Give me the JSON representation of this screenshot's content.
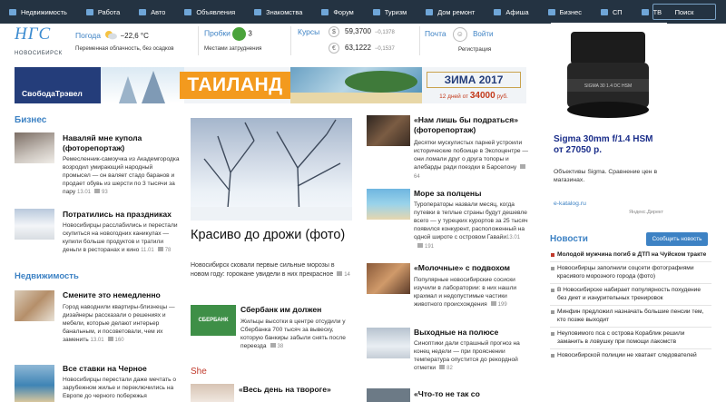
{
  "nav": {
    "items": [
      "Недвижимость",
      "Работа",
      "Авто",
      "Объявления",
      "Знакомства",
      "Форум",
      "Туризм",
      "Дом ремонт",
      "Афиша",
      "Бизнес",
      "СП",
      "ТВ"
    ],
    "search_label": "Поиск"
  },
  "header": {
    "logo": "НГС",
    "city": "НОВОСИБИРСК",
    "weather_label": "Погода",
    "weather_value": "−22,6 °С",
    "weather_sub": "Переменная облачность, без осадков",
    "traffic_label": "Пробки",
    "traffic_value": "3",
    "traffic_sub": "Местами затруднения",
    "rates_label": "Курсы",
    "usd_value": "59,3700",
    "usd_change": "−0,1378",
    "eur_value": "63,1222",
    "eur_change": "−0,1537",
    "usd_symbol": "$",
    "eur_symbol": "€",
    "mail_label": "Почта",
    "login_label": "Войти",
    "register_label": "Регистрация"
  },
  "banner": {
    "brand": "СвободаТрэвел",
    "destination": "ТАИЛАНД",
    "season": "ЗИМА 2017",
    "price_prefix": "12 дней от",
    "price": "34000",
    "price_suffix": "руб."
  },
  "sections": {
    "business": "Бизнес",
    "realty": "Недвижимость",
    "she": "She"
  },
  "left_articles": [
    {
      "title": "Наваляй мне купола (фоторепортаж)",
      "text": "Ремесленник-самоучка из Академгородка возродил умирающий народный промысел — он валяет стадо баранов и продает обувь из шерсти по 3 тысячи за пару",
      "date": "13.01",
      "comments": "93"
    },
    {
      "title": "Потратились на праздниках",
      "text": "Новосибирцы расслабились и перестали скупиться на новогодних каникулах — купили больше продуктов и тратили деньги в ресторанах и кино",
      "date": "11.01",
      "comments": "78"
    },
    {
      "title": "Смените это немедленно",
      "text": "Город наводнили квартиры-близнецы — дизайнеры рассказали о решениях и мебели, которые делают интерьер банальным, и посоветовали, чем их заменить",
      "date": "13.01",
      "comments": "160"
    },
    {
      "title": "Все ставки на Черное",
      "text": "Новосибирцы перестали даже мечтать о зарубежном жилье и переключились на Европе до черного побережья",
      "date": "",
      "comments": ""
    }
  ],
  "lead": {
    "title": "Красиво до дрожи (фото)",
    "text": "Новосибирск сковали первые сильные морозы в новом году: горожане увидели в них прекрасное",
    "comments": "14"
  },
  "mid_article": {
    "title": "Сбербанк им должен",
    "text": "Жильцы высотки в центре отсудили у Сбербанка 700 тысяч за вывеску, которую банкиры забыли снять после переезда",
    "comments": "38",
    "logo_text": "СБЕРБАНК"
  },
  "she_article": {
    "title": "«Весь день на творогe»"
  },
  "right_articles": [
    {
      "title": "«Нам лишь бы подраться» (фоторепортаж)",
      "text": "Десятки мускулистых парней устроили исторические побоище в Экспоцентре — они ломали друг о друга топоры и алебарды ради поездки в Барселону",
      "comments": "64"
    },
    {
      "title": "Море за полцены",
      "text": "Туроператоры назвали месяц, когда путевки в теплые страны будут дешевле всего — у турецких курортов за 25 тысяч появился конкурент, расположенный на одной широте с островом Гавайи",
      "date": "13.01",
      "comments": "191"
    },
    {
      "title": "«Молочные» с подвохом",
      "text": "Популярные новосибирские сосиски изучили в лаборатории: в них нашли крахмал и недопустимые частики животного происхождения",
      "comments": "199"
    },
    {
      "title": "Выходные на полюсе",
      "text": "Синоптики дали страшный прогноз на конец недели — при прояснении температура опустится до рекордной отметки",
      "comments": "82"
    },
    {
      "title": "«Что-то не так со"
    }
  ],
  "ad": {
    "title": "Sigma 30mm f/1.4 HSM от 27050 р.",
    "text": "Объективы Sigma. Сравнение цен в магазинах.",
    "link": "e-katalog.ru",
    "source": "Яндекс.Директ"
  },
  "news": {
    "heading": "Новости",
    "button": "Сообщить новость",
    "items": [
      {
        "text": "Молодой мужчина погиб в ДТП на Чуйском тракте",
        "hot": true
      },
      {
        "text": "Новосибирцы заполнили соцсети фотографиями красивого морозного города (фото)",
        "hot": false
      },
      {
        "text": "В Новосибирске набирает популярность похудение без диет и изнурительных тренировок",
        "hot": false
      },
      {
        "text": "Минфин предложил назначать большие пенсии тем, кто позже выходит",
        "hot": false
      },
      {
        "text": "Неуловимого пса с острова Кораблик решили заманить в ловушку при помощи лакомств",
        "hot": false
      },
      {
        "text": "Новосибирской полиции не хватает следователей",
        "hot": false
      }
    ]
  },
  "colors": {
    "nav_bg": "#243342",
    "accent": "#3d82c4",
    "she": "#c0392b",
    "banner_orange": "#f39a1e"
  }
}
